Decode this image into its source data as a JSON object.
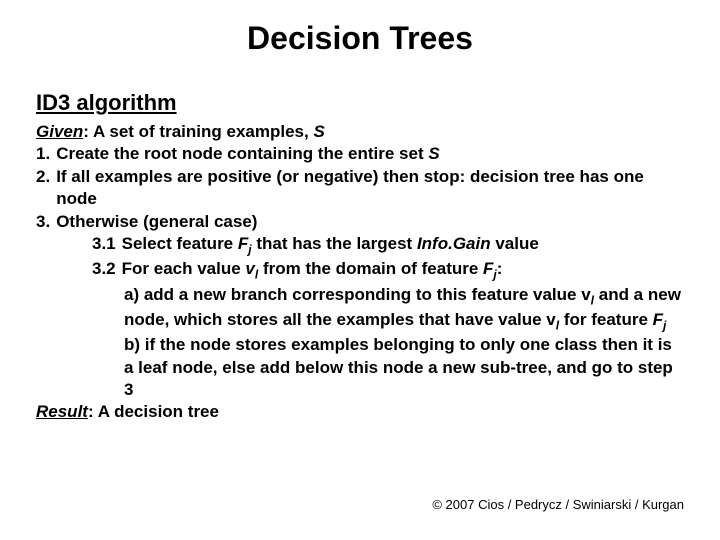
{
  "title": "Decision Trees",
  "section": "ID3 algorithm",
  "given_prefix": "Given",
  "given_rest": ": A set of training examples, ",
  "given_sym": "S",
  "s1_num": "1.",
  "s1_a": " Create the root node containing the entire set ",
  "s1_b": "S",
  "s2_num": "2.",
  "s2_a": " If all examples are positive (or negative) then stop: decision tree has one node",
  "s3_num": "3.",
  "s3_a": " Otherwise (general case)",
  "s31_num": "3.1",
  "s31_a": " Select feature ",
  "s31_fj": "F",
  "s31_j": "j",
  "s31_b": " that has the largest ",
  "s31_ig": "Info.Gain",
  "s31_c": " value",
  "s32_num": "3.2",
  "s32_a": " For each value ",
  "s32_v": "v",
  "s32_lsub": "l",
  "s32_b": " from the domain of feature ",
  "s32_fj": "F",
  "s32_j": "j",
  "s32_c": ":",
  "s32a_num": "a)",
  "s32a_1": " add a new branch corresponding to this feature value v",
  "s32a_2": " and a new node, which stores all the examples that have value v",
  "s32a_3": " for feature ",
  "s32a_fj": "F",
  "s32a_j": "j",
  "s32b_num": "b)",
  "s32b_1": " if the node stores examples belonging to only one class then it is a leaf node, else add below this node a new sub-tree, and go to step 3",
  "result_prefix": "Result",
  "result_rest": ": A decision tree",
  "footer": "© 2007 Cios / Pedrycz / Swiniarski / Kurgan"
}
